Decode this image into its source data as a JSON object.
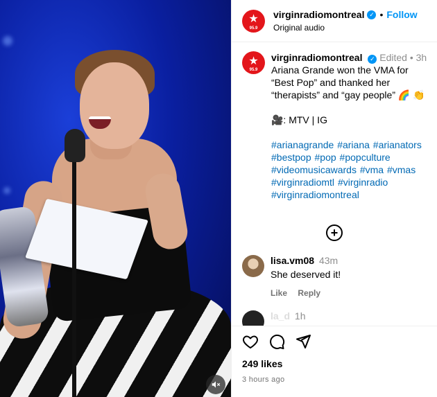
{
  "account": {
    "username": "virginradiomontreal",
    "follow_label": "Follow",
    "subtitle": "Original audio",
    "logo_freq": "95.9"
  },
  "caption": {
    "username": "virginradiomontreal",
    "edited": "Edited",
    "time": "3h",
    "text": "Ariana Grande won the VMA for “Best Pop” and thanked her “therapists” and “gay people” 🌈 👏",
    "credit": "🎥: MTV | IG",
    "hashtags": [
      "#arianagrande",
      "#ariana",
      "#arianators",
      "#bestpop",
      "#pop",
      "#popculture",
      "#videomusicawards",
      "#vma",
      "#vmas",
      "#virginradiomtl",
      "#virginradio",
      "#virginradiomontreal"
    ]
  },
  "comments": [
    {
      "username": "lisa.vm08",
      "time": "43m",
      "text": "She deserved it!",
      "like_label": "Like",
      "reply_label": "Reply"
    }
  ],
  "partial_comment": {
    "username": "la_d",
    "time": "1h"
  },
  "post": {
    "likes": "249 likes",
    "ago": "3 hours ago"
  },
  "icons": [
    "verified-icon",
    "add-comment-icon",
    "heart-icon",
    "comment-icon",
    "share-icon",
    "mute-icon"
  ],
  "colors": {
    "brand_red": "#e3161b",
    "link_blue": "#0095f6",
    "hashtag_blue": "#0069b4"
  }
}
